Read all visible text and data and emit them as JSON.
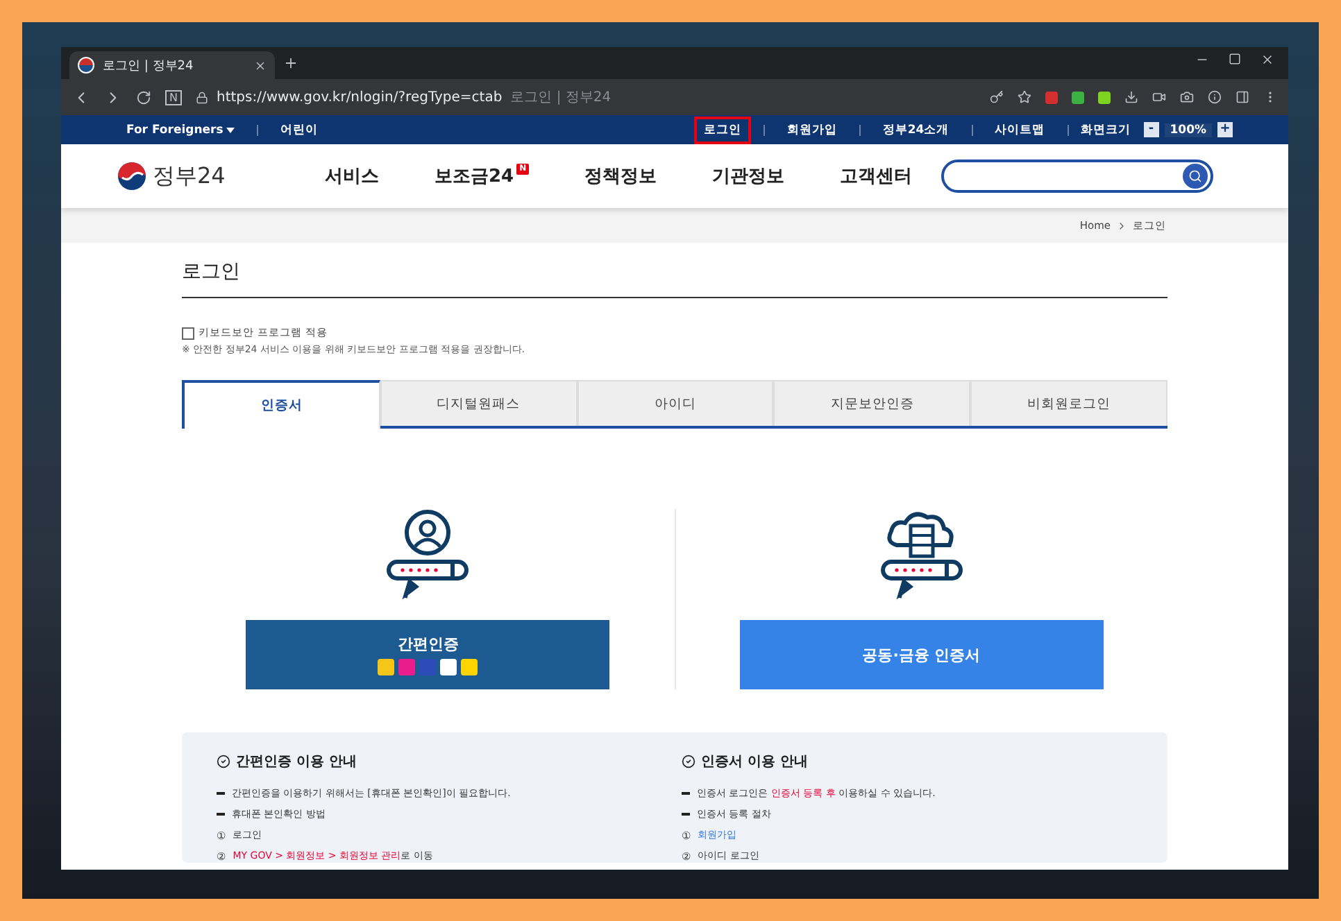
{
  "browser": {
    "tab_title": "로그인 | 정부24",
    "url": "https://www.gov.kr/nlogin/?regType=ctab",
    "url_page_title": "로그인 | 정부24",
    "reader_button": "N"
  },
  "top_bar": {
    "left_links": [
      {
        "label": "For Foreigners",
        "dropdown": true
      },
      {
        "label": "어린이",
        "dropdown": false
      }
    ],
    "right_links": [
      {
        "label": "로그인",
        "highlighted": true
      },
      {
        "label": "회원가입",
        "highlighted": false
      },
      {
        "label": "정부24소개",
        "highlighted": false
      },
      {
        "label": "사이트맵",
        "highlighted": false
      }
    ],
    "zoom": {
      "label": "화면크기",
      "minus": "-",
      "value": "100%",
      "plus": "+"
    }
  },
  "header": {
    "logo": "정부24",
    "nav": [
      {
        "label": "서비스"
      },
      {
        "label": "보조금24",
        "badge": "N"
      },
      {
        "label": "정책정보"
      },
      {
        "label": "기관정보"
      },
      {
        "label": "고객센터"
      }
    ]
  },
  "breadcrumb": [
    "Home",
    "로그인"
  ],
  "page_title": "로그인",
  "keyboard_security": {
    "label": "키보드보안 프로그램 적용",
    "checked": false,
    "notice": "※ 안전한 정부24 서비스 이용을 위해 키보드보안 프로그램 적용을 권장합니다."
  },
  "tabs": [
    {
      "label": "인증서",
      "selected": true
    },
    {
      "label": "디지털원패스",
      "selected": false
    },
    {
      "label": "아이디",
      "selected": false
    },
    {
      "label": "지문보안인증",
      "selected": false
    },
    {
      "label": "비회원로그인",
      "selected": false
    }
  ],
  "login_options": [
    {
      "kind": "simple",
      "label": "간편인증"
    },
    {
      "kind": "certificate",
      "label": "공동·금융 인증서"
    }
  ],
  "guides": [
    {
      "title": "간편인증 이용 안내",
      "items": [
        {
          "kind": "dash",
          "marker": "",
          "segments": [
            {
              "kind": "text",
              "text": "간편인증을 이용하기 위해서는 [휴대폰 본인확인]이 필요합니다."
            }
          ]
        },
        {
          "kind": "dash",
          "marker": "",
          "segments": [
            {
              "kind": "text",
              "text": "휴대폰 본인확인 방법"
            }
          ]
        },
        {
          "kind": "step",
          "marker": "①",
          "segments": [
            {
              "kind": "text",
              "text": "로그인"
            }
          ]
        },
        {
          "kind": "step",
          "marker": "②",
          "segments": [
            {
              "kind": "red",
              "text": "MY GOV > 회원정보 > 회원정보 관리"
            },
            {
              "kind": "text",
              "text": "로 이동"
            }
          ]
        }
      ]
    },
    {
      "title": "인증서 이용 안내",
      "items": [
        {
          "kind": "dash",
          "marker": "",
          "segments": [
            {
              "kind": "text",
              "text": "인증서 로그인은 "
            },
            {
              "kind": "red",
              "text": "인증서 등록 후"
            },
            {
              "kind": "text",
              "text": " 이용하실 수 있습니다."
            }
          ]
        },
        {
          "kind": "dash",
          "marker": "",
          "segments": [
            {
              "kind": "text",
              "text": "인증서 등록 절차"
            }
          ]
        },
        {
          "kind": "step",
          "marker": "①",
          "segments": [
            {
              "kind": "link",
              "text": "회원가입"
            }
          ]
        },
        {
          "kind": "step",
          "marker": "②",
          "segments": [
            {
              "kind": "text",
              "text": "아이디 로그인"
            }
          ]
        }
      ]
    }
  ]
}
